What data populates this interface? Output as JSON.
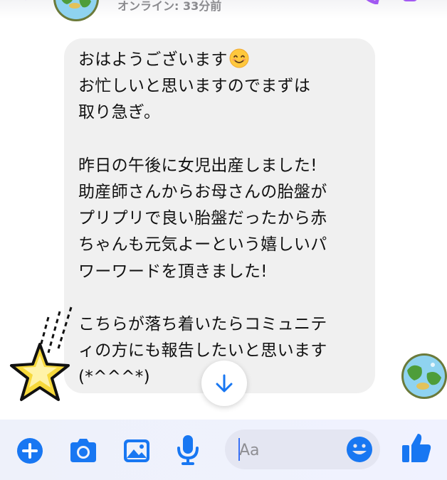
{
  "header": {
    "status": "オンライン: 33分前"
  },
  "message": {
    "text": "おはようございます",
    "emoji": "smiling-face-emoji",
    "body": "お忙しいと思いますのでまずは\n取り急ぎ。\n\n昨日の午後に女児出産しました!\n助産師さんからお母さんの胎盤が\nプリプリで良い胎盤だったから赤\nちゃんも元気よーという嬉しいパ\nワーワードを頂きました!\n\nこちらが落ち着いたらコミュニテ\nィの方にも報告したいと思います\n(*^^^*)"
  },
  "composer": {
    "placeholder": "Aa"
  },
  "colors": {
    "accent": "#1877f2",
    "bubble": "#f0f0f0"
  }
}
